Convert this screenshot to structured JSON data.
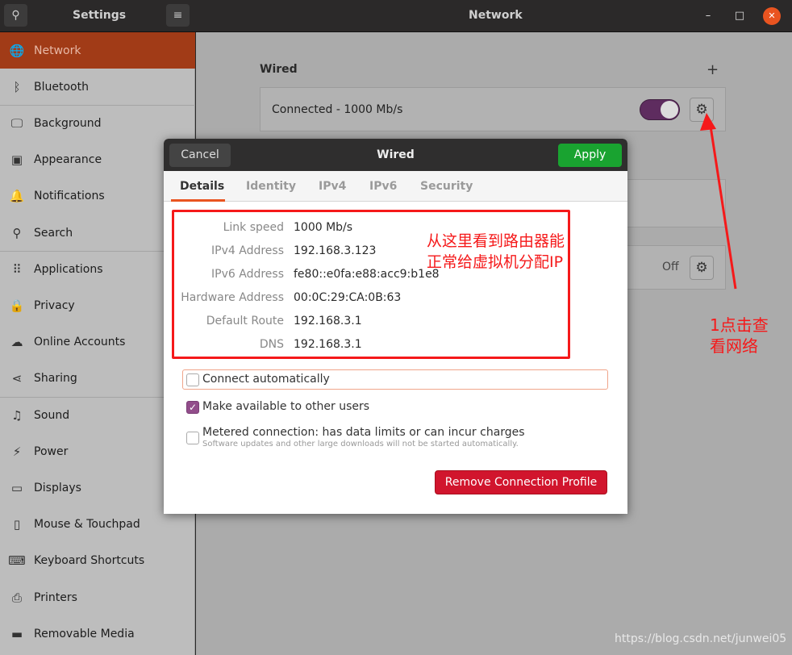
{
  "titlebar": {
    "settings_title": "Settings",
    "page_title": "Network",
    "search_icon": "search-icon",
    "menu_icon": "hamburger-icon",
    "minimize": "–",
    "maximize": "□",
    "close": "✕"
  },
  "sidebar": {
    "items": [
      {
        "label": "Network",
        "icon": "🌐"
      },
      {
        "label": "Bluetooth",
        "icon": "ᛒ"
      },
      {
        "label": "Background",
        "icon": "🖵"
      },
      {
        "label": "Appearance",
        "icon": "▣"
      },
      {
        "label": "Notifications",
        "icon": "🔔"
      },
      {
        "label": "Search",
        "icon": "⚲"
      },
      {
        "label": "Applications",
        "icon": "⠿"
      },
      {
        "label": "Privacy",
        "icon": "🔒"
      },
      {
        "label": "Online Accounts",
        "icon": "☁"
      },
      {
        "label": "Sharing",
        "icon": "⋖"
      },
      {
        "label": "Sound",
        "icon": "♫"
      },
      {
        "label": "Power",
        "icon": "⚡"
      },
      {
        "label": "Displays",
        "icon": "▭"
      },
      {
        "label": "Mouse & Touchpad",
        "icon": "▯"
      },
      {
        "label": "Keyboard Shortcuts",
        "icon": "⌨"
      },
      {
        "label": "Printers",
        "icon": "⎙"
      },
      {
        "label": "Removable Media",
        "icon": "▬"
      }
    ],
    "active": "Network"
  },
  "main": {
    "wired_title": "Wired",
    "add": "+",
    "wired_status": "Connected - 1000 Mb/s",
    "wired_toggle_on": true,
    "vpn_status": "Off",
    "gear_glyph": "⚙"
  },
  "dialog": {
    "title": "Wired",
    "cancel": "Cancel",
    "apply": "Apply",
    "tabs": [
      "Details",
      "Identity",
      "IPv4",
      "IPv6",
      "Security"
    ],
    "active_tab": "Details",
    "details": [
      {
        "label": "Link speed",
        "value": "1000 Mb/s"
      },
      {
        "label": "IPv4 Address",
        "value": "192.168.3.123"
      },
      {
        "label": "IPv6 Address",
        "value": "fe80::e0fa:e88:acc9:b1e8"
      },
      {
        "label": "Hardware Address",
        "value": "00:0C:29:CA:0B:63"
      },
      {
        "label": "Default Route",
        "value": "192.168.3.1"
      },
      {
        "label": "DNS",
        "value": "192.168.3.1"
      }
    ],
    "connect_auto": {
      "label": "Connect automatically",
      "checked": false
    },
    "available_all": {
      "label": "Make available to other users",
      "checked": true
    },
    "metered": {
      "label": "Metered connection: has data limits or can incur charges",
      "sub": "Software updates and other large downloads will not be started automatically.",
      "checked": false
    },
    "remove": "Remove Connection Profile"
  },
  "annotations": {
    "note1": "从这里看到路由器能正常给虚拟机分配IP",
    "note2": "1点击查看网络",
    "color": "#f5191a"
  },
  "watermark": "https://blog.csdn.net/junwei05",
  "colors": {
    "accent": "#e95420",
    "apply": "#19a330",
    "remove": "#d1152d",
    "check": "#924d8b"
  }
}
